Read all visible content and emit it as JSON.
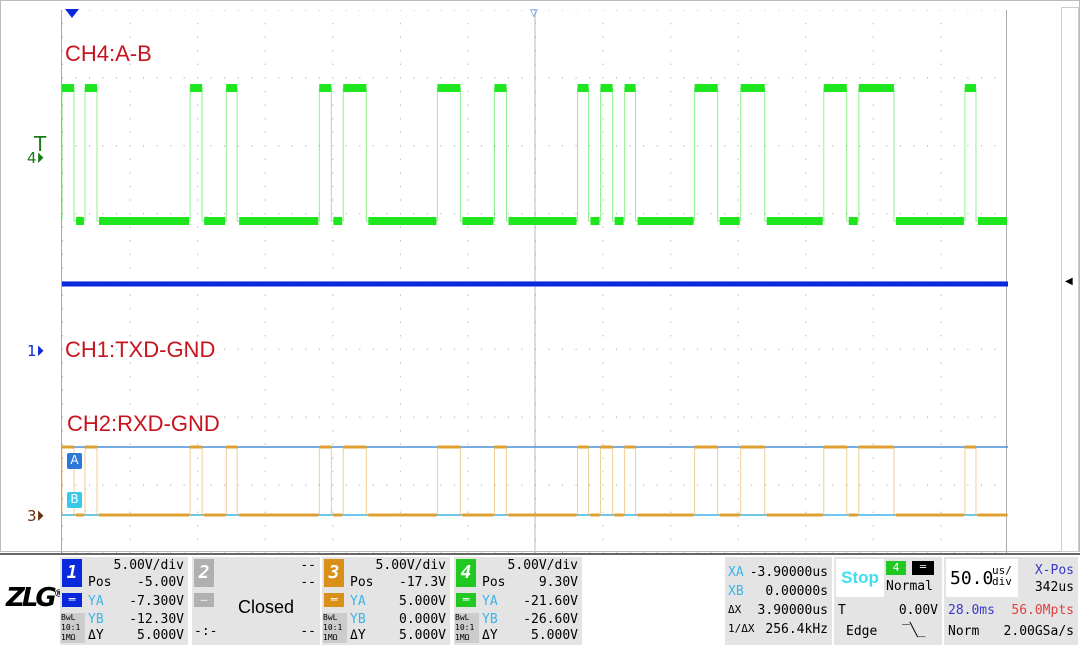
{
  "screen": {
    "labels": {
      "ch4": "CH4:A-B",
      "ch1": "CH1:TXD-GND",
      "ch2": "CH2:RXD-GND"
    },
    "markers": {
      "ch4": "4",
      "trigger": "T",
      "ch1": "1",
      "ch3": "3",
      "cursor_a": "A",
      "cursor_b": "B"
    },
    "colors": {
      "ch1": "#0a28dc",
      "ch3": "#e0a030",
      "ch4": "#1ee61e",
      "cursor": "#3cb4e6",
      "label": "#c8141e"
    },
    "time_span_us": 700,
    "ch4_high_intervals_us": [
      [
        0,
        8.9
      ],
      [
        17.0,
        25.9
      ],
      [
        94.8,
        103.7
      ],
      [
        121.5,
        129.6
      ],
      [
        190.4,
        199.3
      ],
      [
        208.1,
        225.2
      ],
      [
        277.8,
        294.8
      ],
      [
        320,
        328.9
      ],
      [
        381.5,
        389.6
      ],
      [
        398.5,
        407.4
      ],
      [
        416.3,
        424.4
      ],
      [
        468.1,
        485.2
      ],
      [
        502.2,
        520
      ],
      [
        563.7,
        580.7
      ],
      [
        589.6,
        615.6
      ],
      [
        668.1,
        676.3
      ]
    ],
    "ch1_state": "constant"
  },
  "logo": "ZLG",
  "channels": [
    {
      "num": "1",
      "color": "#0a28dc",
      "scale": "5.00V/div",
      "pos_label": "Pos",
      "pos": "-5.00V",
      "ya": "-7.300V",
      "yb": "-12.30V",
      "dy": "5.000V",
      "bw": "BwL",
      "probe": "10:1",
      "imp": "1MΩ"
    },
    {
      "num": "2",
      "color": "#b0b0b0",
      "scale": "--",
      "pos": "--",
      "status": "Closed",
      "dy": "--",
      "misc": "-:-"
    },
    {
      "num": "3",
      "color": "#d89018",
      "scale": "5.00V/div",
      "pos_label": "Pos",
      "pos": "-17.3V",
      "ya": "5.000V",
      "yb": "0.000V",
      "dy": "5.000V",
      "bw": "BwL",
      "probe": "10:1",
      "imp": "1MΩ"
    },
    {
      "num": "4",
      "color": "#22c822",
      "scale": "5.00V/div",
      "pos_label": "Pos",
      "pos": "9.30V",
      "ya": "-21.60V",
      "yb": "-26.60V",
      "dy": "5.000V",
      "bw": "BwL",
      "probe": "10:1",
      "imp": "1MΩ"
    }
  ],
  "cursor_labels": {
    "ya": "YA",
    "yb": "YB",
    "dy": "ΔY"
  },
  "cursors": {
    "xa_label": "XA",
    "xa": "-3.90000us",
    "xb_label": "XB",
    "xb": "0.00000s",
    "dx_label": "ΔX",
    "dx": "3.90000us",
    "inv_label": "1/ΔX",
    "inv": "256.4kHz"
  },
  "trigger": {
    "state": "Stop",
    "source": "4",
    "mode": "Normal",
    "t_label": "T",
    "level": "0.00V",
    "type": "Edge"
  },
  "timebase": {
    "scale": "50.0",
    "unit_top": "us/",
    "unit_bot": "div",
    "xpos_label": "X-Pos",
    "xpos": "342us",
    "length": "28.0ms",
    "points": "56.0Mpts",
    "acq": "Norm",
    "rate": "2.00GSa/s"
  }
}
